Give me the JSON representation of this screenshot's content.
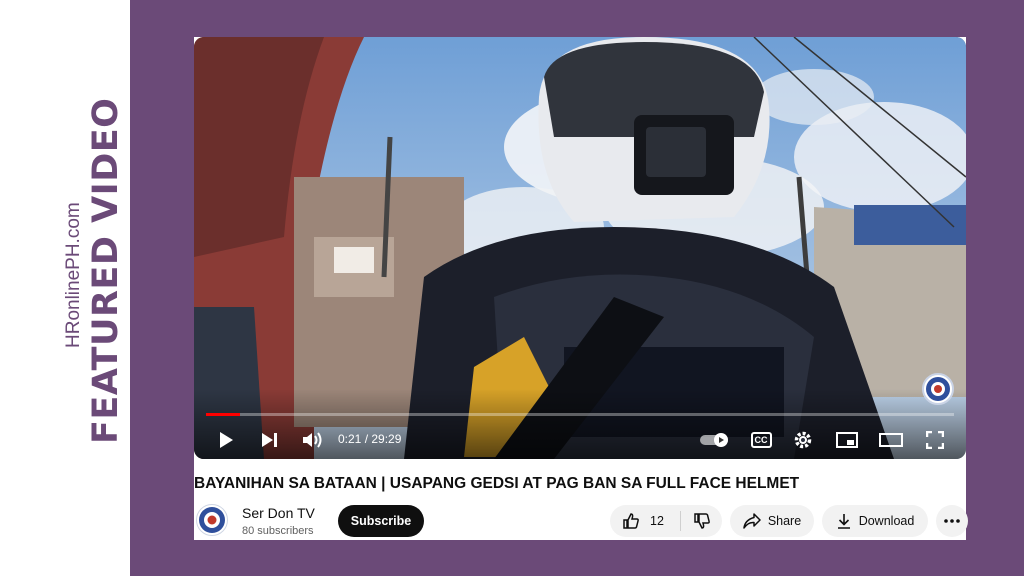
{
  "sidebar": {
    "featured_label": "FEATURED VIDEO",
    "site_label": "HRonlinePH.com"
  },
  "player": {
    "progress_fraction": 0.012,
    "time_current": "0:21",
    "time_separator": " / ",
    "time_total": "29:29",
    "controls": [
      "play-icon",
      "next-icon",
      "volume-icon",
      "autoplay-toggle-icon",
      "captions-icon",
      "gear-icon",
      "miniplayer-icon",
      "theater-icon",
      "fullscreen-icon"
    ],
    "captions_label": "CC"
  },
  "video": {
    "title": "BAYANIHAN SA BATAAN | USAPANG GEDSI AT PAG BAN SA FULL FACE HELMET"
  },
  "channel": {
    "name": "Ser Don TV",
    "subscribers": "80 subscribers",
    "subscribe_label": "Subscribe"
  },
  "actions": {
    "like_count": "12",
    "share_label": "Share",
    "download_label": "Download"
  },
  "colors": {
    "background": "#6b4a78",
    "progress": "#ff0000",
    "subscribe_bg": "#0f0f0f"
  }
}
